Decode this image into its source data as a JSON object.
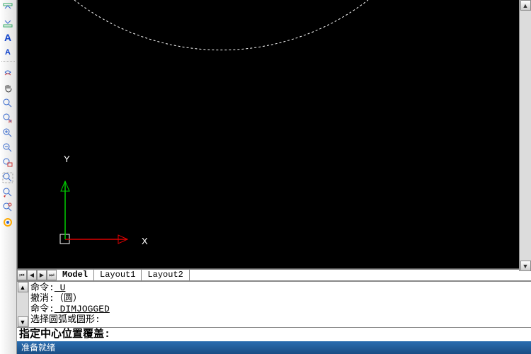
{
  "toolbar_icons": [
    "align-top",
    "align-bottom",
    "text-A",
    "text-A-small",
    "sep",
    "realtime-zoom",
    "pan-hand",
    "zoom-region",
    "zoom-in-R",
    "zoom-in",
    "zoom-out",
    "zoom-window",
    "zoom-extents",
    "zoom-previous",
    "zoom-obj",
    "regen"
  ],
  "tabs": {
    "active": "Model",
    "items": [
      "Model",
      "Layout1",
      "Layout2"
    ]
  },
  "cmd_history": [
    {
      "label": "命令:",
      "value": " U"
    },
    {
      "label": "撤消:",
      "value": "（圆）"
    },
    {
      "label": "命令:",
      "value": " DIMJOGGED"
    },
    {
      "label": "选择圆弧或圆形:",
      "value": ""
    }
  ],
  "cmd_prompt": "指定中心位置覆盖:",
  "status_text": "准备就绪",
  "axis": {
    "x": "X",
    "y": "Y"
  },
  "scroll_arrows": {
    "up": "▲",
    "down": "▼",
    "first": "⏮",
    "prev": "◀",
    "next": "▶",
    "last": "⏭"
  }
}
